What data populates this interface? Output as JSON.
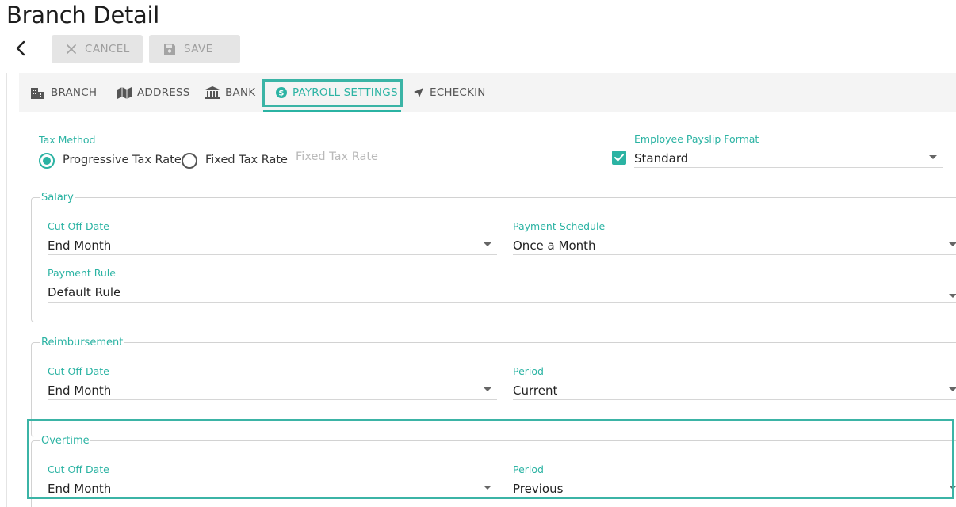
{
  "page": {
    "title": "Branch Detail"
  },
  "toolbar": {
    "cancel_label": "CANCEL",
    "save_label": "SAVE"
  },
  "tabs": [
    {
      "label": "BRANCH",
      "icon": "building-icon",
      "active": false
    },
    {
      "label": "ADDRESS",
      "icon": "map-icon",
      "active": false
    },
    {
      "label": "BANK",
      "icon": "bank-icon",
      "active": false
    },
    {
      "label": "PAYROLL SETTINGS",
      "icon": "dollar-circle-icon",
      "active": true
    },
    {
      "label": "ECHECKIN",
      "icon": "navigation-arrow-icon",
      "active": false
    }
  ],
  "tax_method": {
    "label": "Tax Method",
    "options": [
      "Progressive Tax Rate",
      "Fixed Tax Rate"
    ],
    "selected": "Progressive Tax Rate",
    "fixed_rate_placeholder": "Fixed Tax Rate"
  },
  "payslip": {
    "label": "Employee Payslip Format",
    "value": "Standard",
    "checked": true
  },
  "salary": {
    "legend": "Salary",
    "cut_off_label": "Cut Off Date",
    "cut_off_value": "End Month",
    "schedule_label": "Payment Schedule",
    "schedule_value": "Once a Month",
    "rule_label": "Payment Rule",
    "rule_value": "Default Rule"
  },
  "reimbursement": {
    "legend": "Reimbursement",
    "cut_off_label": "Cut Off Date",
    "cut_off_value": "End Month",
    "period_label": "Period",
    "period_value": "Current"
  },
  "overtime": {
    "legend": "Overtime",
    "cut_off_label": "Cut Off Date",
    "cut_off_value": "End Month",
    "period_label": "Period",
    "period_value": "Previous"
  },
  "colors": {
    "accent": "#2bb3a3",
    "highlight": "#3bb4a6",
    "disabled_button": "#e5e5e5"
  }
}
